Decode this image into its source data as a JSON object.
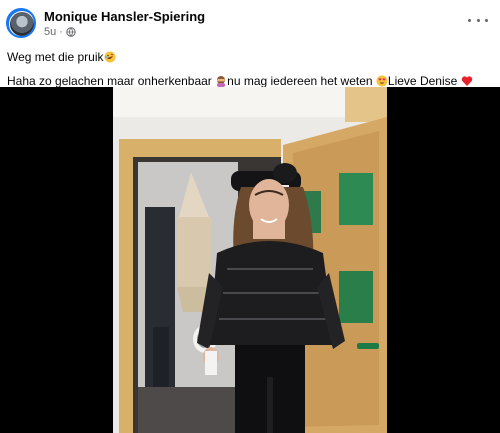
{
  "post": {
    "author": "Monique Hansler-Spiering",
    "time": "5u",
    "separator": "·",
    "audience_icon": "globe-icon",
    "line1": "Weg met die pruik",
    "line1_emoji": "rolling-on-floor-laughing-emoji",
    "line2_a": "Haha zo gelachen maar onherkenbaar ",
    "line2_emoji1": "see-no-evil-person-emoji",
    "line2_b": "nu mag iedereen het weten ",
    "line2_emoji2": "heart-eyes-emoji",
    "line2_c": "Lieve Denise ",
    "line2_emoji3": "red-heart-emoji",
    "more_icon": "more-horizontal-icon"
  },
  "colors": {
    "accent": "#1877f2",
    "text": "#050505",
    "secondary_text": "#65676b",
    "media_background": "#000000"
  }
}
